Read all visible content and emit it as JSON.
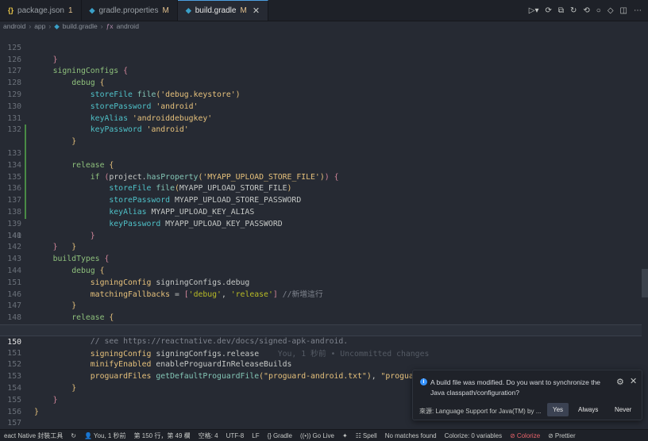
{
  "tabs": [
    {
      "label": "package.json",
      "badge": "1",
      "icon": "json-icon"
    },
    {
      "label": "gradle.properties",
      "badge": "M",
      "icon": "gradle-icon"
    },
    {
      "label": "build.gradle",
      "badge": "M",
      "icon": "gradle-icon",
      "active": true
    }
  ],
  "breadcrumb": [
    "android",
    "app",
    "build.gradle",
    "android"
  ],
  "editor": {
    "current_line": "150",
    "blame_text": "You, 1 秒前 • Uncommitted changes"
  },
  "notification": {
    "message": "A build file was modified. Do you want to synchronize the Java classpath/configuration?",
    "source": "來源: Language Support for Java(TM) by ...",
    "yes": "Yes",
    "always": "Always",
    "never": "Never"
  },
  "statusbar": {
    "left_label": "eact Native 封裝工具",
    "blame": "You, 1 秒前",
    "position": "第 150 行，第 49 欄",
    "spaces": "空格: 4",
    "encoding": "UTF-8",
    "eol": "LF",
    "language": "Gradle",
    "golive": "Go Live",
    "spell": "Spell",
    "matches": "No matches found",
    "colorize_vars": "Colorize: 0 variables",
    "colorize": "Colorize",
    "prettier": "Prettier"
  },
  "colors": {
    "accent": "#4d9fe0",
    "modified_gutter": "#4a8b45",
    "error": "#e8636a"
  }
}
